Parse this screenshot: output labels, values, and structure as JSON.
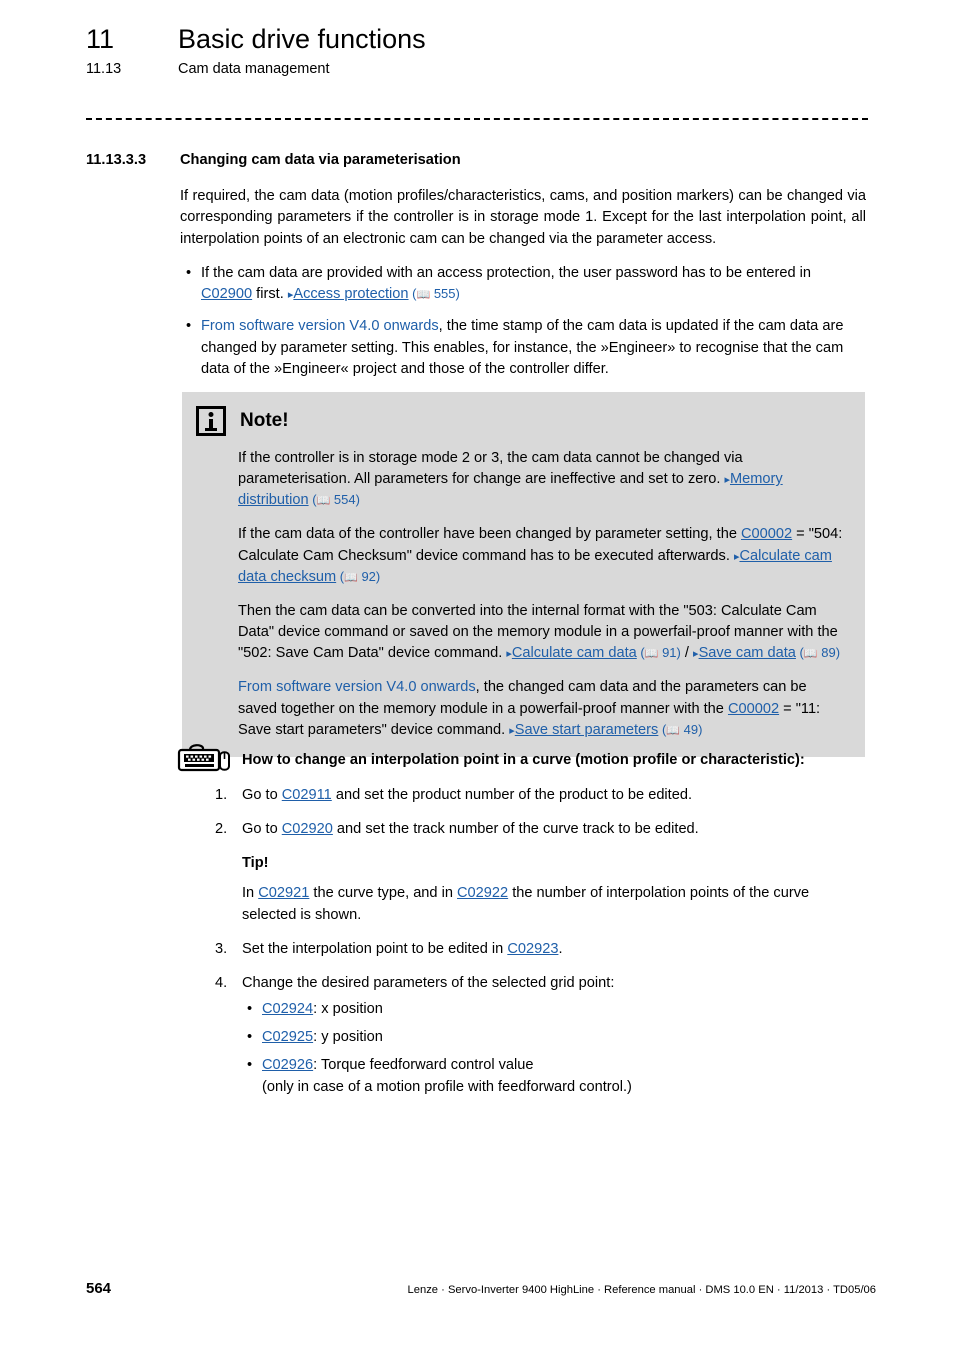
{
  "header": {
    "chapter_number": "11",
    "chapter_title": "Basic drive functions",
    "section_number": "11.13",
    "section_title": "Cam data management"
  },
  "section": {
    "number": "11.13.3.3",
    "title": "Changing cam data via parameterisation"
  },
  "intro": {
    "paragraph": "If required, the cam data (motion profiles/characteristics, cams, and position markers) can be changed via corresponding parameters if the controller is in storage mode 1. Except for the last interpolation point, all interpolation points of an electronic cam can be changed via the parameter access."
  },
  "bullets": [
    {
      "text_before": "If the cam data are provided with an access protection, the user password has to be entered in ",
      "link_param": "C02900",
      "text_mid": " first. ",
      "arrow": "▸",
      "xref_label": "Access protection",
      "xref_page": "555"
    },
    {
      "highlight": "From software version V4.0 onwards",
      "text_after": ", the time stamp of the cam data is updated if the cam data are changed by parameter setting. This enables, for instance, the »Engineer» to recognise that the cam data of the »Engineer« project and those of the controller differ."
    }
  ],
  "note": {
    "icon_name": "info-icon",
    "title": "Note!",
    "background_color": "#D9D9D9",
    "paragraphs": [
      {
        "id": "p1",
        "text_before": "If the controller is in storage mode 2 or 3, the cam data cannot be changed via parameterisation. All parameters for change are ineffective and set to zero. ",
        "arrow": "▸",
        "xref_label": "Memory distribution",
        "xref_page": "554"
      },
      {
        "id": "p2",
        "text_before": "If the cam data of the controller have been changed by parameter setting, the ",
        "link_param": "C00002",
        "text_mid": " = \"504: Calculate Cam Checksum\" device command has to be executed afterwards. ",
        "arrow": "▸",
        "xref_label": "Calculate cam data checksum",
        "xref_page": "92"
      },
      {
        "id": "p3",
        "text_before": "Then the cam data can be converted into the internal format with the \"503: Calculate Cam Data\" device command or saved on the memory module in a powerfail-proof manner with the \"502: Save Cam Data\" device command. ",
        "arrow": "▸",
        "xref_label": "Calculate cam data",
        "xref_page": "91",
        "separator": " / ",
        "arrow2": "▸",
        "xref_label2": "Save cam data",
        "xref_page2": "89"
      },
      {
        "id": "p4",
        "highlight": "From software version V4.0 onwards",
        "text_before": ", the changed cam data and the parameters can be saved together on the memory module in a powerfail-proof manner with the ",
        "link_param": "C00002",
        "text_mid": " = \"11: Save start parameters\" device command. ",
        "arrow": "▸",
        "xref_label": "Save start parameters",
        "xref_page": "49"
      }
    ]
  },
  "howto": {
    "icon_name": "keyboard-mouse-icon",
    "title": "How to change an interpolation point in a curve (motion profile or characteristic):",
    "steps": [
      {
        "text_before": "Go to ",
        "link_param": "C02911",
        "text_after": " and set the product number of the product to be edited."
      },
      {
        "text_before": "Go to ",
        "link_param": "C02920",
        "text_after": " and set the track number of the curve track to be edited."
      },
      {
        "text_before": "Set the interpolation point to be edited in ",
        "link_param": "C02923",
        "text_after": "."
      },
      {
        "text_before": "Change the desired parameters of the selected grid point:",
        "link_param": "",
        "text_after": ""
      }
    ],
    "tip": {
      "title": "Tip!",
      "text_before": "In  ",
      "link_param_1": "C02921",
      "text_mid": " the curve type, and in  ",
      "link_param_2": "C02922",
      "text_after": " the number of interpolation points of the curve selected is shown."
    },
    "sub_items": [
      {
        "link_param": "C02924",
        "text": ": x position"
      },
      {
        "link_param": "C02925",
        "text": ": y position"
      },
      {
        "link_param": "C02926",
        "text": ": Torque feedforward control value",
        "text_line2": "(only in case of a motion profile with feedforward control.)"
      }
    ]
  },
  "footer": {
    "page_number": "564",
    "text": "Lenze · Servo-Inverter 9400 HighLine · Reference manual · DMS 10.0 EN · 11/2013 · TD05/06"
  },
  "colors": {
    "link": "#1F5FA9",
    "note_bg": "#D9D9D9",
    "text": "#000000"
  }
}
